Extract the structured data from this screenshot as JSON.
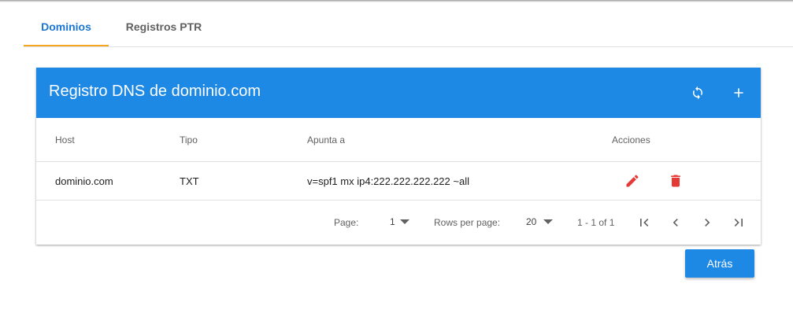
{
  "tabs": [
    {
      "label": "Dominios",
      "active": true
    },
    {
      "label": "Registros PTR",
      "active": false
    }
  ],
  "card": {
    "title": "Registro DNS de dominio.com",
    "header_actions": [
      "refresh-icon",
      "add-icon"
    ]
  },
  "table": {
    "columns": [
      "Host",
      "Tipo",
      "Apunta a",
      "Acciones"
    ],
    "rows": [
      {
        "host": "dominio.com",
        "tipo": "TXT",
        "apunta_a": "v=spf1 mx ip4:222.222.222.222 ~all",
        "actions": [
          "edit-icon",
          "delete-icon"
        ]
      }
    ]
  },
  "pagination": {
    "page_label": "Page:",
    "page_value": "1",
    "rows_label": "Rows per page:",
    "rows_value": "20",
    "range": "1 - 1 of 1"
  },
  "back_button": "Atrás",
  "colors": {
    "primary": "#1e88e5",
    "active_tab_text": "#1976d2",
    "tab_indicator": "#f5a623",
    "danger": "#e53935"
  }
}
